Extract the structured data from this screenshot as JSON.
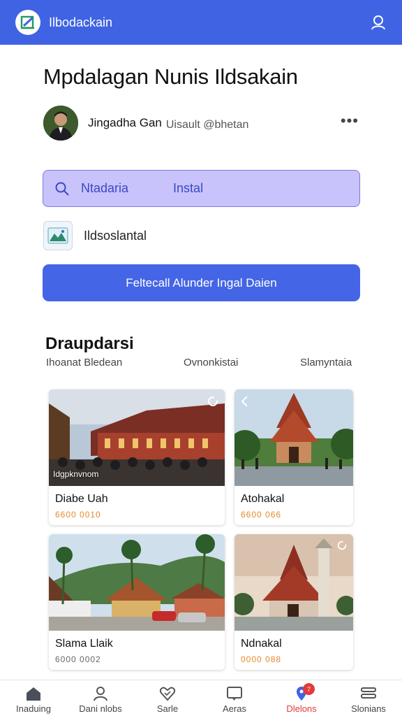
{
  "app": {
    "title": "Ilbodackain"
  },
  "header": {
    "profile_icon": "user-icon"
  },
  "page": {
    "title": "Mpdalagan Nunis Ildsakain"
  },
  "author": {
    "name": "Jingadha Gan",
    "handle": "Uisault @bhetan",
    "more_icon": "more-horizontal-icon"
  },
  "search": {
    "value": "Ntadaria",
    "placeholder": "Instal",
    "icon": "search-icon"
  },
  "file": {
    "label": "Ildsoslantal",
    "icon": "image-file-icon"
  },
  "primary_button": {
    "label": "Feltecall Alunder Ingal Daien"
  },
  "section": {
    "title": "Draupdarsi",
    "tabs": [
      "Ihoanat Bledean",
      "Ovnonkistai",
      "Slamyntaia"
    ]
  },
  "cards": [
    {
      "name": "Diabe Uah",
      "price": "6600 0010",
      "caption": "Idgpknvnom",
      "corner_icon": "refresh-icon"
    },
    {
      "name": "Atohakal",
      "price": "6600 066",
      "caption": "",
      "corner_icon": "chevron-left-icon"
    },
    {
      "name": "Slama Llaik",
      "price": "6000 0002",
      "caption": "",
      "corner_icon": ""
    },
    {
      "name": "Ndnakal",
      "price": "0000 088",
      "caption": "",
      "corner_icon": "refresh-icon"
    }
  ],
  "bottom_nav": [
    {
      "label": "Inaduing",
      "icon": "home-icon",
      "active": false
    },
    {
      "label": "Dani nlobs",
      "icon": "profile-icon",
      "active": false
    },
    {
      "label": "Sarle",
      "icon": "heart-icon",
      "active": false
    },
    {
      "label": "Aeras",
      "icon": "message-icon",
      "active": false
    },
    {
      "label": "Dlelons",
      "icon": "location-icon",
      "active": true,
      "badge": "7"
    },
    {
      "label": "Slonians",
      "icon": "menu-icon",
      "active": false
    }
  ],
  "colors": {
    "brand": "#3f63e3",
    "search_bg": "#c8c3fb",
    "price": "#e6892a",
    "active": "#e23a3a"
  }
}
